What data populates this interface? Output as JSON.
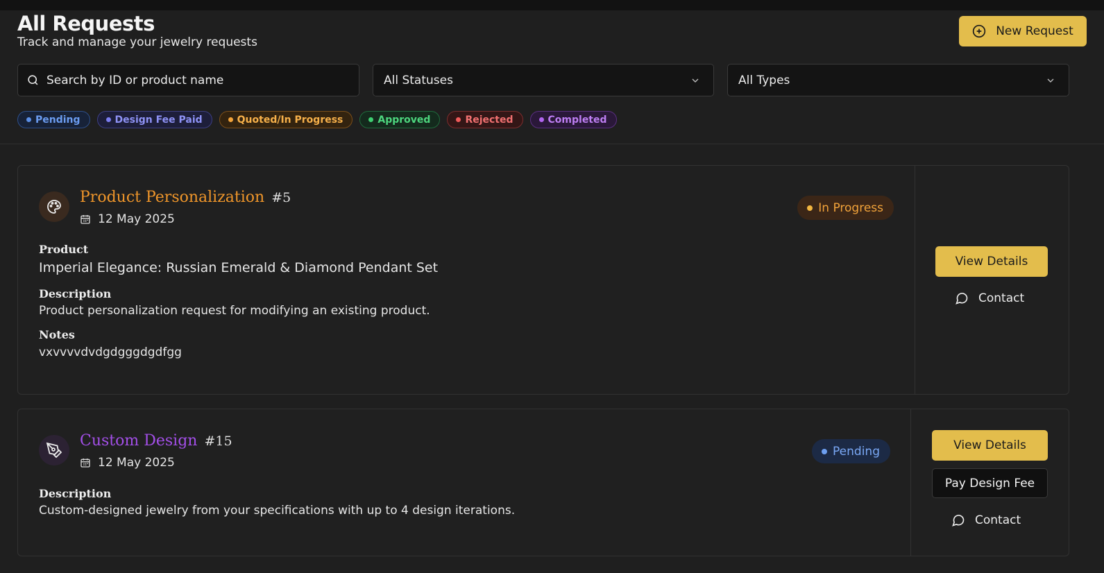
{
  "header": {
    "title": "All Requests",
    "subtitle": "Track and manage your jewelry requests",
    "new_request_label": "New Request"
  },
  "filters": {
    "search_placeholder": "Search by ID or product name",
    "status_select": "All Statuses",
    "type_select": "All Types"
  },
  "legend": [
    {
      "label": "Pending",
      "color": "#5b8fe6"
    },
    {
      "label": "Design Fee Paid",
      "color": "#7b7df0"
    },
    {
      "label": "Quoted/In Progress",
      "color": "#f2a33a"
    },
    {
      "label": "Approved",
      "color": "#3fcf72"
    },
    {
      "label": "Rejected",
      "color": "#ef5a5a"
    },
    {
      "label": "Completed",
      "color": "#b065ee"
    }
  ],
  "requests": [
    {
      "type_title": "Product Personalization",
      "id_label": "#5",
      "date": "12 May 2025",
      "status": "In Progress",
      "product_label": "Product",
      "product_value": "Imperial Elegance: Russian Emerald & Diamond Pendant Set",
      "description_label": "Description",
      "description_value": "Product personalization request for modifying an existing product.",
      "notes_label": "Notes",
      "notes_value": "vxvvvvdvdgdgggdgdfgg",
      "view_details_label": "View Details",
      "contact_label": "Contact",
      "title_color": "#f0962a"
    },
    {
      "type_title": "Custom Design",
      "id_label": "#15",
      "date": "12 May 2025",
      "status": "Pending",
      "description_label": "Description",
      "description_value": "Custom-designed jewelry from your specifications with up to 4 design iterations.",
      "view_details_label": "View Details",
      "pay_fee_label": "Pay Design Fee",
      "contact_label": "Contact",
      "title_color": "#a34fe8"
    }
  ]
}
